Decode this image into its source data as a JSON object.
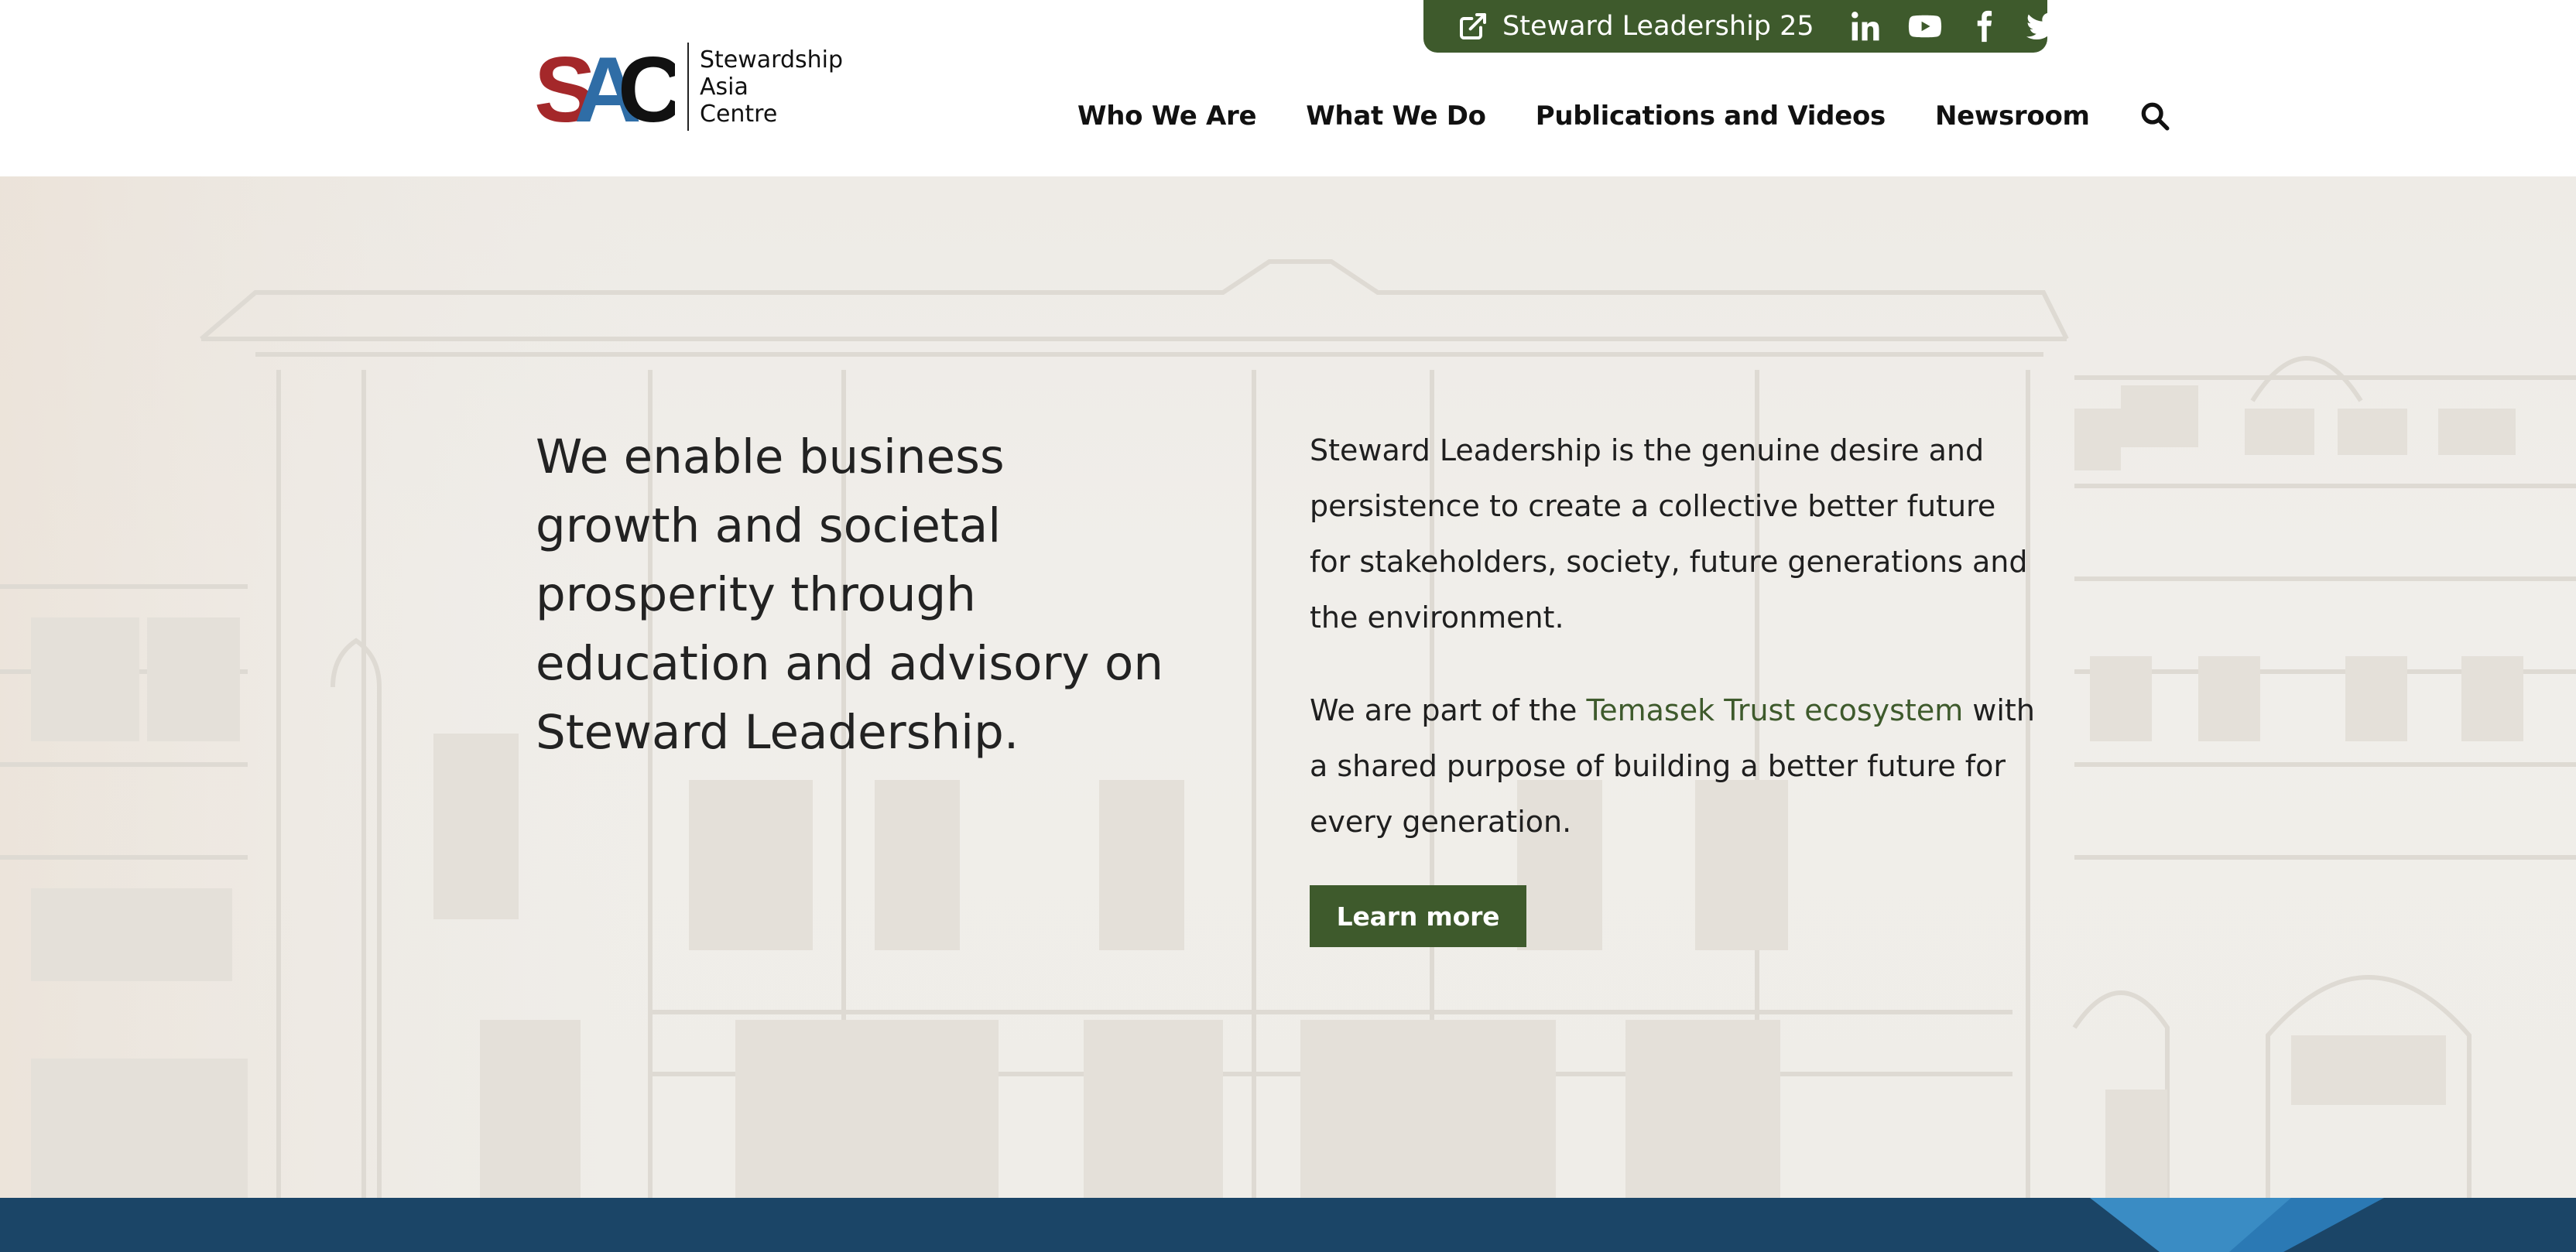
{
  "header": {
    "topbar": {
      "external_link_label": "Steward Leadership 25",
      "socials": [
        "linkedin-icon",
        "youtube-icon",
        "facebook-icon",
        "twitter-icon"
      ]
    },
    "logo": {
      "mark_letters": "SAC",
      "line1": "Stewardship",
      "line2": "Asia",
      "line3": "Centre"
    },
    "nav": {
      "items": [
        {
          "label": "Who We Are"
        },
        {
          "label": "What We Do"
        },
        {
          "label": "Publications and Videos"
        },
        {
          "label": "Newsroom"
        }
      ],
      "search_icon": "search-icon"
    }
  },
  "hero": {
    "headline": "We enable business growth and societal prosperity through education and advisory on Steward Leadership.",
    "para1": "Steward Leadership is the genuine desire and persistence to create a collective better future for stakeholders, society, future generations and the environment.",
    "para2_before": "We are part of the ",
    "para2_link": "Temasek Trust ecosystem",
    "para2_after": " with a shared purpose of building a better future for every generation.",
    "button_label": "Learn more"
  },
  "colors": {
    "brand_green": "#3e5a2c",
    "logo_red": "#a4282a",
    "logo_blue": "#2f6da6",
    "footer_band": "#1b4567",
    "hero_bg": "#efede9"
  }
}
